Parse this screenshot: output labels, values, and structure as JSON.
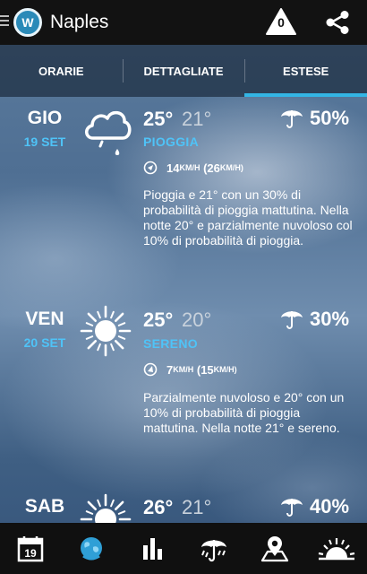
{
  "app": {
    "title": "Naples",
    "alert_count": "0"
  },
  "tabs": [
    {
      "label": "ORARIE",
      "active": false
    },
    {
      "label": "DETTAGLIATE",
      "active": false
    },
    {
      "label": "ESTESE",
      "active": true
    }
  ],
  "days": [
    {
      "name": "GIO",
      "date": "19 SET",
      "icon": "rain-cloud-icon",
      "tmax": "25°",
      "tmin": "21°",
      "condition": "PIOGGIA",
      "wind_speed": "14",
      "wind_unit": "KM/H",
      "wind_gust": "(26",
      "wind_gust_unit": "KM/H)",
      "pop": "50%",
      "description": "Pioggia e 21° con un 30% di probabilità di pioggia mattutina. Nella notte 20° e parzialmente nuvoloso col 10% di probabilità di pioggia."
    },
    {
      "name": "VEN",
      "date": "20 SET",
      "icon": "sun-icon",
      "tmax": "25°",
      "tmin": "20°",
      "condition": "SERENO",
      "wind_speed": "7",
      "wind_unit": "KM/H",
      "wind_gust": "(15",
      "wind_gust_unit": "KM/H)",
      "pop": "30%",
      "description": "Parzialmente nuvoloso e 20° con un 10% di probabilità di pioggia mattutina. Nella notte 21° e sereno."
    },
    {
      "name": "SAB",
      "icon": "sun-icon",
      "tmax": "26°",
      "tmin": "21°",
      "pop": "40%"
    }
  ],
  "bottom_nav": [
    {
      "icon": "calendar-icon",
      "text": "19",
      "active": false
    },
    {
      "icon": "globe-icon",
      "active": true
    },
    {
      "icon": "bar-chart-icon",
      "active": false
    },
    {
      "icon": "rain-umbrella-icon",
      "active": false
    },
    {
      "icon": "map-pin-icon",
      "active": false
    },
    {
      "icon": "sunset-icon",
      "active": false
    }
  ],
  "colors": {
    "accent": "#33b5e5",
    "date_blue": "#4fc3f7",
    "bar": "#121212"
  }
}
